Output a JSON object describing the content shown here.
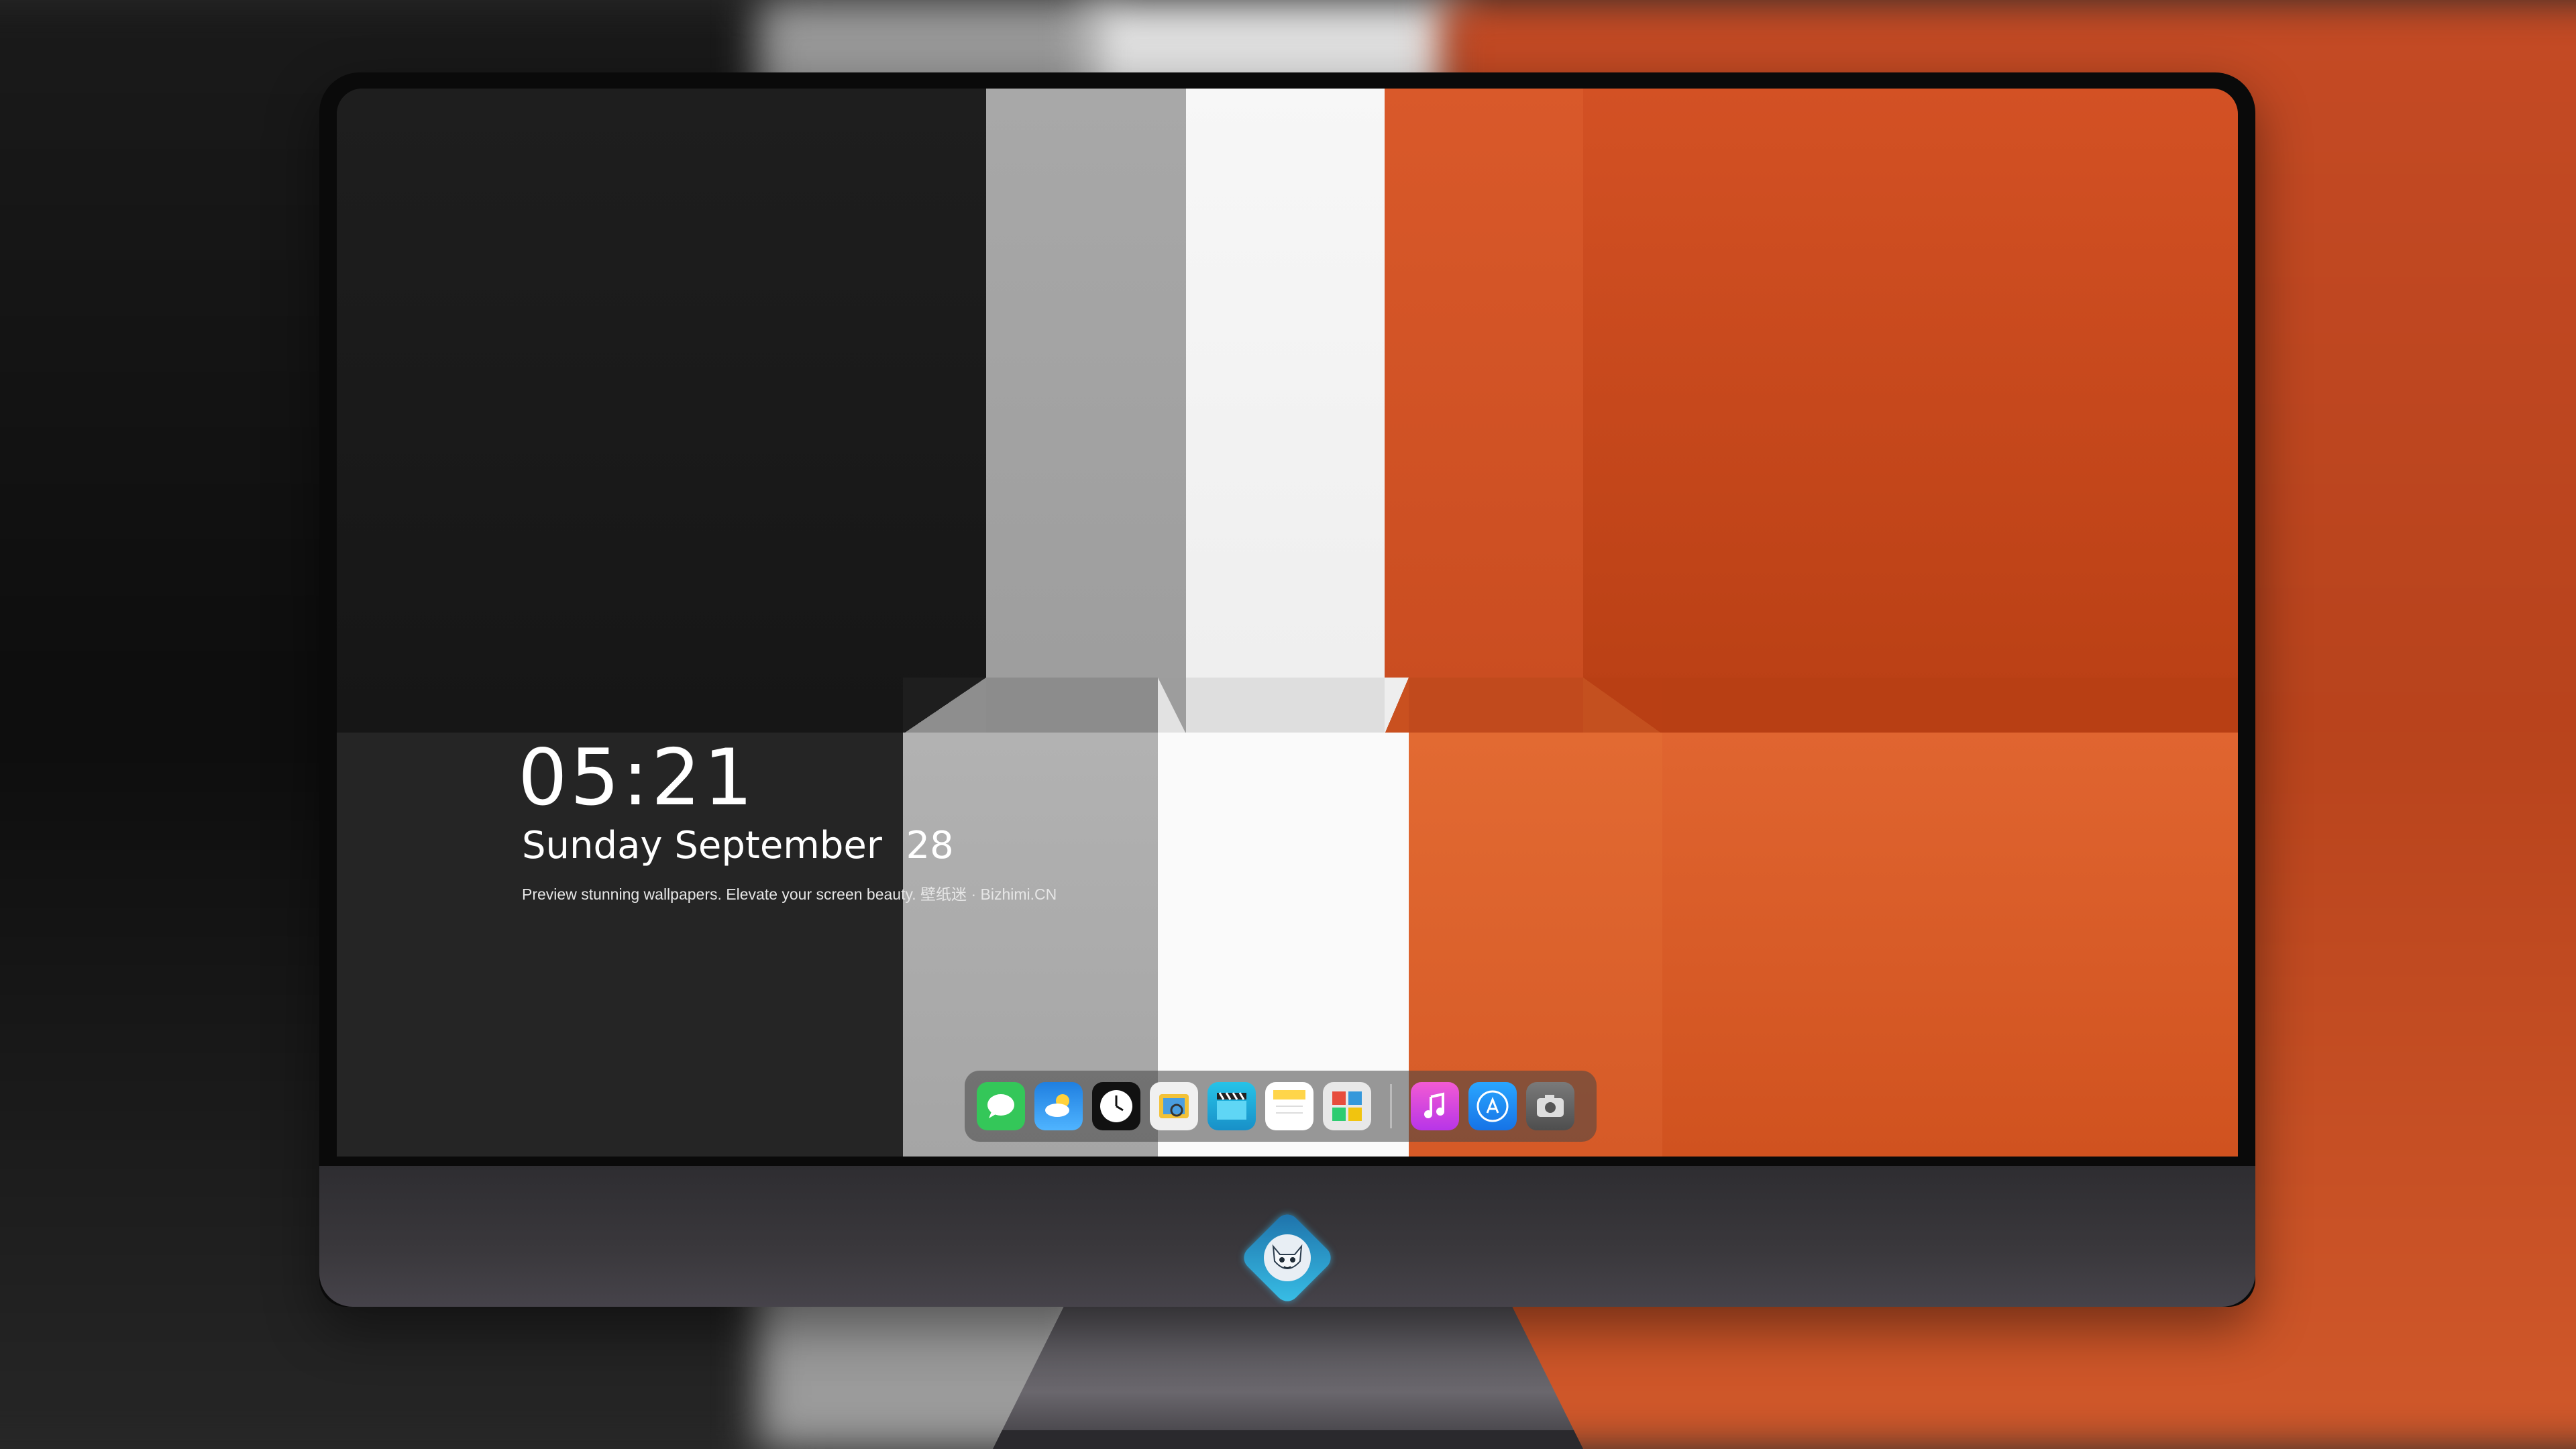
{
  "lockscreen": {
    "time": "05:21",
    "date": "Sunday September  28",
    "tagline": "Preview stunning wallpapers. Elevate your screen beauty. 壁纸迷 · Bizhimi.CN"
  },
  "dock": {
    "apps": [
      {
        "name": "messages",
        "color": "#34c759"
      },
      {
        "name": "weather",
        "color": "#1e8cf0"
      },
      {
        "name": "clock",
        "color": "#ffffff"
      },
      {
        "name": "preview",
        "color": "#f3c237"
      },
      {
        "name": "clips",
        "color": "#27c3e8"
      },
      {
        "name": "notes",
        "color": "#ffd54a"
      },
      {
        "name": "photo-booth",
        "color": "#e8e8e8"
      },
      {
        "name": "music",
        "color": "#e043d6"
      },
      {
        "name": "app-store",
        "color": "#1a8ef5"
      },
      {
        "name": "camera",
        "color": "#6a6a6a"
      }
    ]
  },
  "colors": {
    "dark": "#1e1e1e",
    "gray": "#a8a8a8",
    "white": "#f7f7f7",
    "orange": "#d35124",
    "logo": "#39c1e8"
  }
}
